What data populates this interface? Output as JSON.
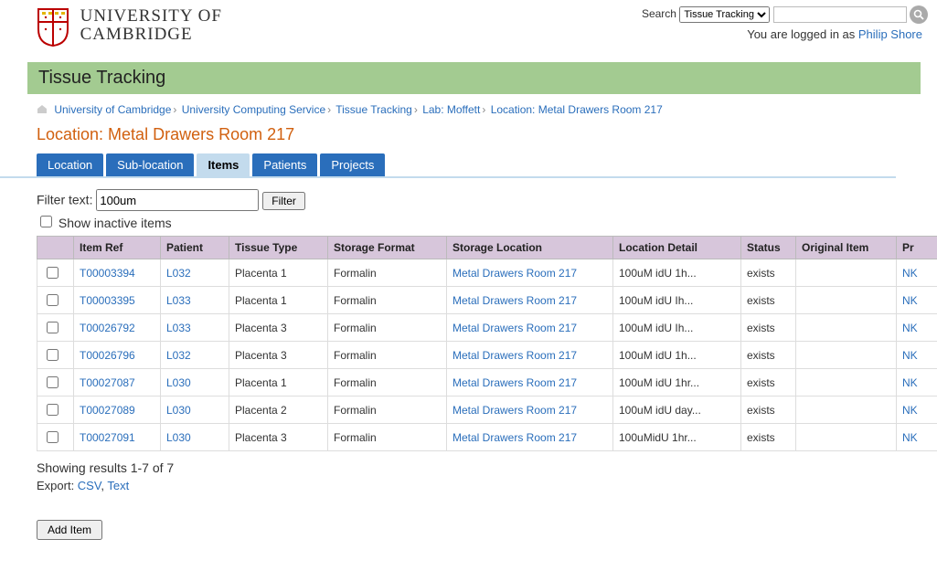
{
  "header": {
    "uni_line1": "UNIVERSITY OF",
    "uni_line2": "CAMBRIDGE",
    "search_label": "Search",
    "search_select": "Tissue Tracking",
    "login_prefix": "You are logged in as ",
    "login_user": "Philip Shore"
  },
  "titlebar": "Tissue Tracking",
  "breadcrumbs": [
    "University of Cambridge",
    "University Computing Service",
    "Tissue Tracking",
    "Lab: Moffett",
    "Location: Metal Drawers Room 217"
  ],
  "page_heading": "Location: Metal Drawers Room 217",
  "tabs": [
    "Location",
    "Sub-location",
    "Items",
    "Patients",
    "Projects"
  ],
  "active_tab": 2,
  "filter": {
    "label": "Filter text:",
    "value": "100um",
    "button": "Filter",
    "inactive": "Show inactive items"
  },
  "columns": [
    "Item Ref",
    "Patient",
    "Tissue Type",
    "Storage Format",
    "Storage Location",
    "Location Detail",
    "Status",
    "Original Item",
    "Pr"
  ],
  "rows": [
    {
      "ref": "T00003394",
      "pat": "L032",
      "tt": "Placenta 1",
      "sf": "Formalin",
      "sl": "Metal Drawers Room 217",
      "ld": "100uM idU 1h...",
      "st": "exists",
      "oi": "",
      "pr": "NK"
    },
    {
      "ref": "T00003395",
      "pat": "L033",
      "tt": "Placenta 1",
      "sf": "Formalin",
      "sl": "Metal Drawers Room 217",
      "ld": "100uM idU Ih...",
      "st": "exists",
      "oi": "",
      "pr": "NK"
    },
    {
      "ref": "T00026792",
      "pat": "L033",
      "tt": "Placenta 3",
      "sf": "Formalin",
      "sl": "Metal Drawers Room 217",
      "ld": "100uM idU Ih...",
      "st": "exists",
      "oi": "",
      "pr": "NK"
    },
    {
      "ref": "T00026796",
      "pat": "L032",
      "tt": "Placenta 3",
      "sf": "Formalin",
      "sl": "Metal Drawers Room 217",
      "ld": "100uM idU 1h...",
      "st": "exists",
      "oi": "",
      "pr": "NK"
    },
    {
      "ref": "T00027087",
      "pat": "L030",
      "tt": "Placenta 1",
      "sf": "Formalin",
      "sl": "Metal Drawers Room 217",
      "ld": "100uM idU 1hr...",
      "st": "exists",
      "oi": "",
      "pr": "NK"
    },
    {
      "ref": "T00027089",
      "pat": "L030",
      "tt": "Placenta 2",
      "sf": "Formalin",
      "sl": "Metal Drawers Room 217",
      "ld": "100uM idU day...",
      "st": "exists",
      "oi": "",
      "pr": "NK"
    },
    {
      "ref": "T00027091",
      "pat": "L030",
      "tt": "Placenta 3",
      "sf": "Formalin",
      "sl": "Metal Drawers Room 217",
      "ld": "100uMidU 1hr...",
      "st": "exists",
      "oi": "",
      "pr": "NK"
    }
  ],
  "results_line": "Showing results 1-7 of 7",
  "export_label": "Export: ",
  "export_csv": "CSV",
  "export_text": "Text",
  "add_button": "Add Item"
}
